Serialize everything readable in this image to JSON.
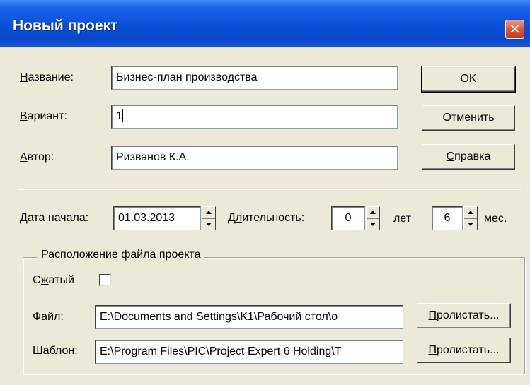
{
  "window": {
    "title": "Новый проект",
    "close_symbol": "✕"
  },
  "fields": {
    "name": {
      "label_u": "Н",
      "label_rest": "азвание:",
      "value": "Бизнес-план производства"
    },
    "variant": {
      "label_u": "В",
      "label_rest": "ариант:",
      "value": "1"
    },
    "author": {
      "label_u": "А",
      "label_rest": "втор:",
      "value": "Ризванов К.А."
    }
  },
  "buttons": {
    "ok": "OK",
    "cancel": "Отменить",
    "help_u": "С",
    "help_rest": "правка",
    "browse_u": "П",
    "browse_rest": "ролистать..."
  },
  "dates": {
    "start_label_u": "Д",
    "start_label_rest": "ата начала:",
    "start_value": "01.03.2013",
    "duration_label_pre": "Д",
    "duration_label_u": "л",
    "duration_label_rest": "ительность:",
    "years_value": "0",
    "years_unit": "лет",
    "months_value": "6",
    "months_unit": "мес."
  },
  "file_location": {
    "group_title": "Расположение файла проекта",
    "compressed_label_pre": "С",
    "compressed_label_u": "ж",
    "compressed_label_rest": "атый",
    "file_label_u": "Ф",
    "file_label_rest": "айл:",
    "file_value": "E:\\Documents and Settings\\K1\\Рабочий стол\\о",
    "template_label_u": "Ш",
    "template_label_rest": "аблон:",
    "template_value": "E:\\Program Files\\PIC\\Project Expert 6 Holding\\T"
  }
}
